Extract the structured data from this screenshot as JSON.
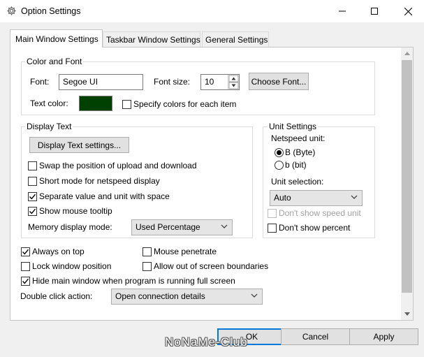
{
  "window": {
    "title": "Option Settings",
    "icon": "gear-icon"
  },
  "tabs": [
    {
      "label": "Main Window Settings",
      "active": true
    },
    {
      "label": "Taskbar Window Settings",
      "active": false
    },
    {
      "label": "General Settings",
      "active": false
    }
  ],
  "color_font": {
    "title": "Color and Font",
    "font_label": "Font:",
    "font_value": "Segoe UI",
    "font_size_label": "Font size:",
    "font_size_value": "10",
    "choose_font_label": "Choose Font...",
    "text_color_label": "Text color:",
    "text_color": "#004000",
    "specify_colors_label": "Specify colors for each item",
    "specify_colors_checked": false
  },
  "display_text": {
    "title": "Display Text",
    "settings_button": "Display Text settings...",
    "options": [
      {
        "label": "Swap the position of upload and download",
        "checked": false
      },
      {
        "label": "Short mode for netspeed display",
        "checked": false
      },
      {
        "label": "Separate value and unit with space",
        "checked": true
      },
      {
        "label": "Show mouse tooltip",
        "checked": true
      }
    ],
    "memory_mode_label": "Memory display mode:",
    "memory_mode_value": "Used Percentage"
  },
  "unit_settings": {
    "title": "Unit Settings",
    "netspeed_label": "Netspeed unit:",
    "byte_label": "B (Byte)",
    "bit_label": "b (bit)",
    "selected": "byte",
    "selection_label": "Unit selection:",
    "selection_value": "Auto",
    "dont_show_speed_unit": "Don't show speed unit",
    "dont_show_percent": "Don't show percent"
  },
  "general": {
    "always_on_top": "Always on top",
    "mouse_penetrate": "Mouse penetrate",
    "lock_window_position": "Lock window position",
    "allow_out_of_screen": "Allow out of screen boundaries",
    "hide_main_window": "Hide main window when program is running full screen",
    "double_click_label": "Double click action:",
    "double_click_value": "Open connection details"
  },
  "buttons": {
    "ok": "OK",
    "cancel": "Cancel",
    "apply": "Apply"
  },
  "watermark": "NoNaMe-Club"
}
